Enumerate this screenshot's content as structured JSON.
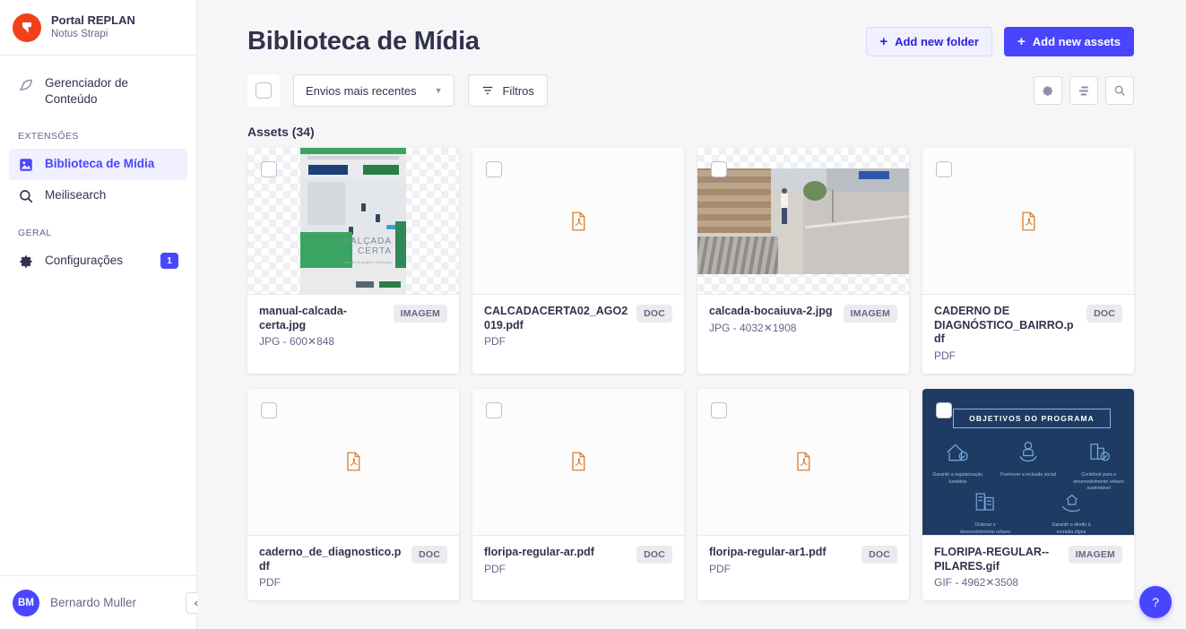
{
  "sidebar": {
    "brand": {
      "title": "Portal REPLAN",
      "subtitle": "Notus Strapi",
      "logo_icon": "strapi-logo-icon"
    },
    "items": [
      {
        "label": "Gerenciador de Conteúdo",
        "icon": "feather-pen-icon",
        "active": false
      }
    ],
    "sections": [
      {
        "label": "EXTENSÕES",
        "items": [
          {
            "label": "Biblioteca de Mídia",
            "icon": "image-icon",
            "active": true
          },
          {
            "label": "Meilisearch",
            "icon": "search-icon",
            "active": false
          }
        ]
      },
      {
        "label": "GERAL",
        "items": [
          {
            "label": "Configurações",
            "icon": "gear-icon",
            "active": false,
            "badge": "1"
          }
        ]
      }
    ],
    "user": {
      "initials": "BM",
      "name": "Bernardo Muller",
      "collapse_icon": "chevron-left-icon"
    }
  },
  "header": {
    "title": "Biblioteca de Mídia",
    "add_folder_label": "Add new folder",
    "add_assets_label": "Add new assets"
  },
  "toolbar": {
    "select_all_checkbox": "",
    "sort_value": "Envios mais recentes",
    "filters_label": "Filtros",
    "settings_icon": "gear-icon",
    "view_icon": "list-view-icon",
    "search_icon": "search-icon"
  },
  "main": {
    "assets_heading": "Assets (34)"
  },
  "assets": [
    {
      "name": "manual-calcada-certa.jpg",
      "meta": "JPG - 600✕848",
      "tag": "IMAGEM",
      "kind": "image-manual"
    },
    {
      "name": "CALCADACERTA02_AGO2019.pdf",
      "meta": "PDF",
      "tag": "DOC",
      "kind": "pdf"
    },
    {
      "name": "calcada-bocaiuva-2.jpg",
      "meta": "JPG - 4032✕1908",
      "tag": "IMAGEM",
      "kind": "image-photo"
    },
    {
      "name": "CADERNO DE DIAGNÓSTICO_BAIRRO.pdf",
      "meta": "PDF",
      "tag": "DOC",
      "kind": "pdf"
    },
    {
      "name": "caderno_de_diagnostico.pdf",
      "meta": "PDF",
      "tag": "DOC",
      "kind": "pdf"
    },
    {
      "name": "floripa-regular-ar.pdf",
      "meta": "PDF",
      "tag": "DOC",
      "kind": "pdf"
    },
    {
      "name": "floripa-regular-ar1.pdf",
      "meta": "PDF",
      "tag": "DOC",
      "kind": "pdf"
    },
    {
      "name": "FLORIPA-REGULAR--PILARES.gif",
      "meta": "GIF - 4962✕3508",
      "tag": "IMAGEM",
      "kind": "image-gif"
    }
  ],
  "gif_thumbnail": {
    "heading": "OBJETIVOS DO PROGRAMA",
    "items": [
      "Garantir a regularização fundiária",
      "Promover a inclusão social",
      "Contribuir para o desenvolvimento urbano sustentável",
      "Ordenar o desenvolvimento urbano",
      "Garantir o direito à moradia digna"
    ]
  },
  "help": {
    "label": "?",
    "icon": "question-mark-icon"
  },
  "colors": {
    "accent": "#4945ff",
    "accent_light": "#f0f0ff",
    "text_dark": "#32324d",
    "text_muted": "#666687",
    "page_bg": "#f6f6f9",
    "logo_red": "#f1411a",
    "pdf_orange": "#d98032"
  }
}
